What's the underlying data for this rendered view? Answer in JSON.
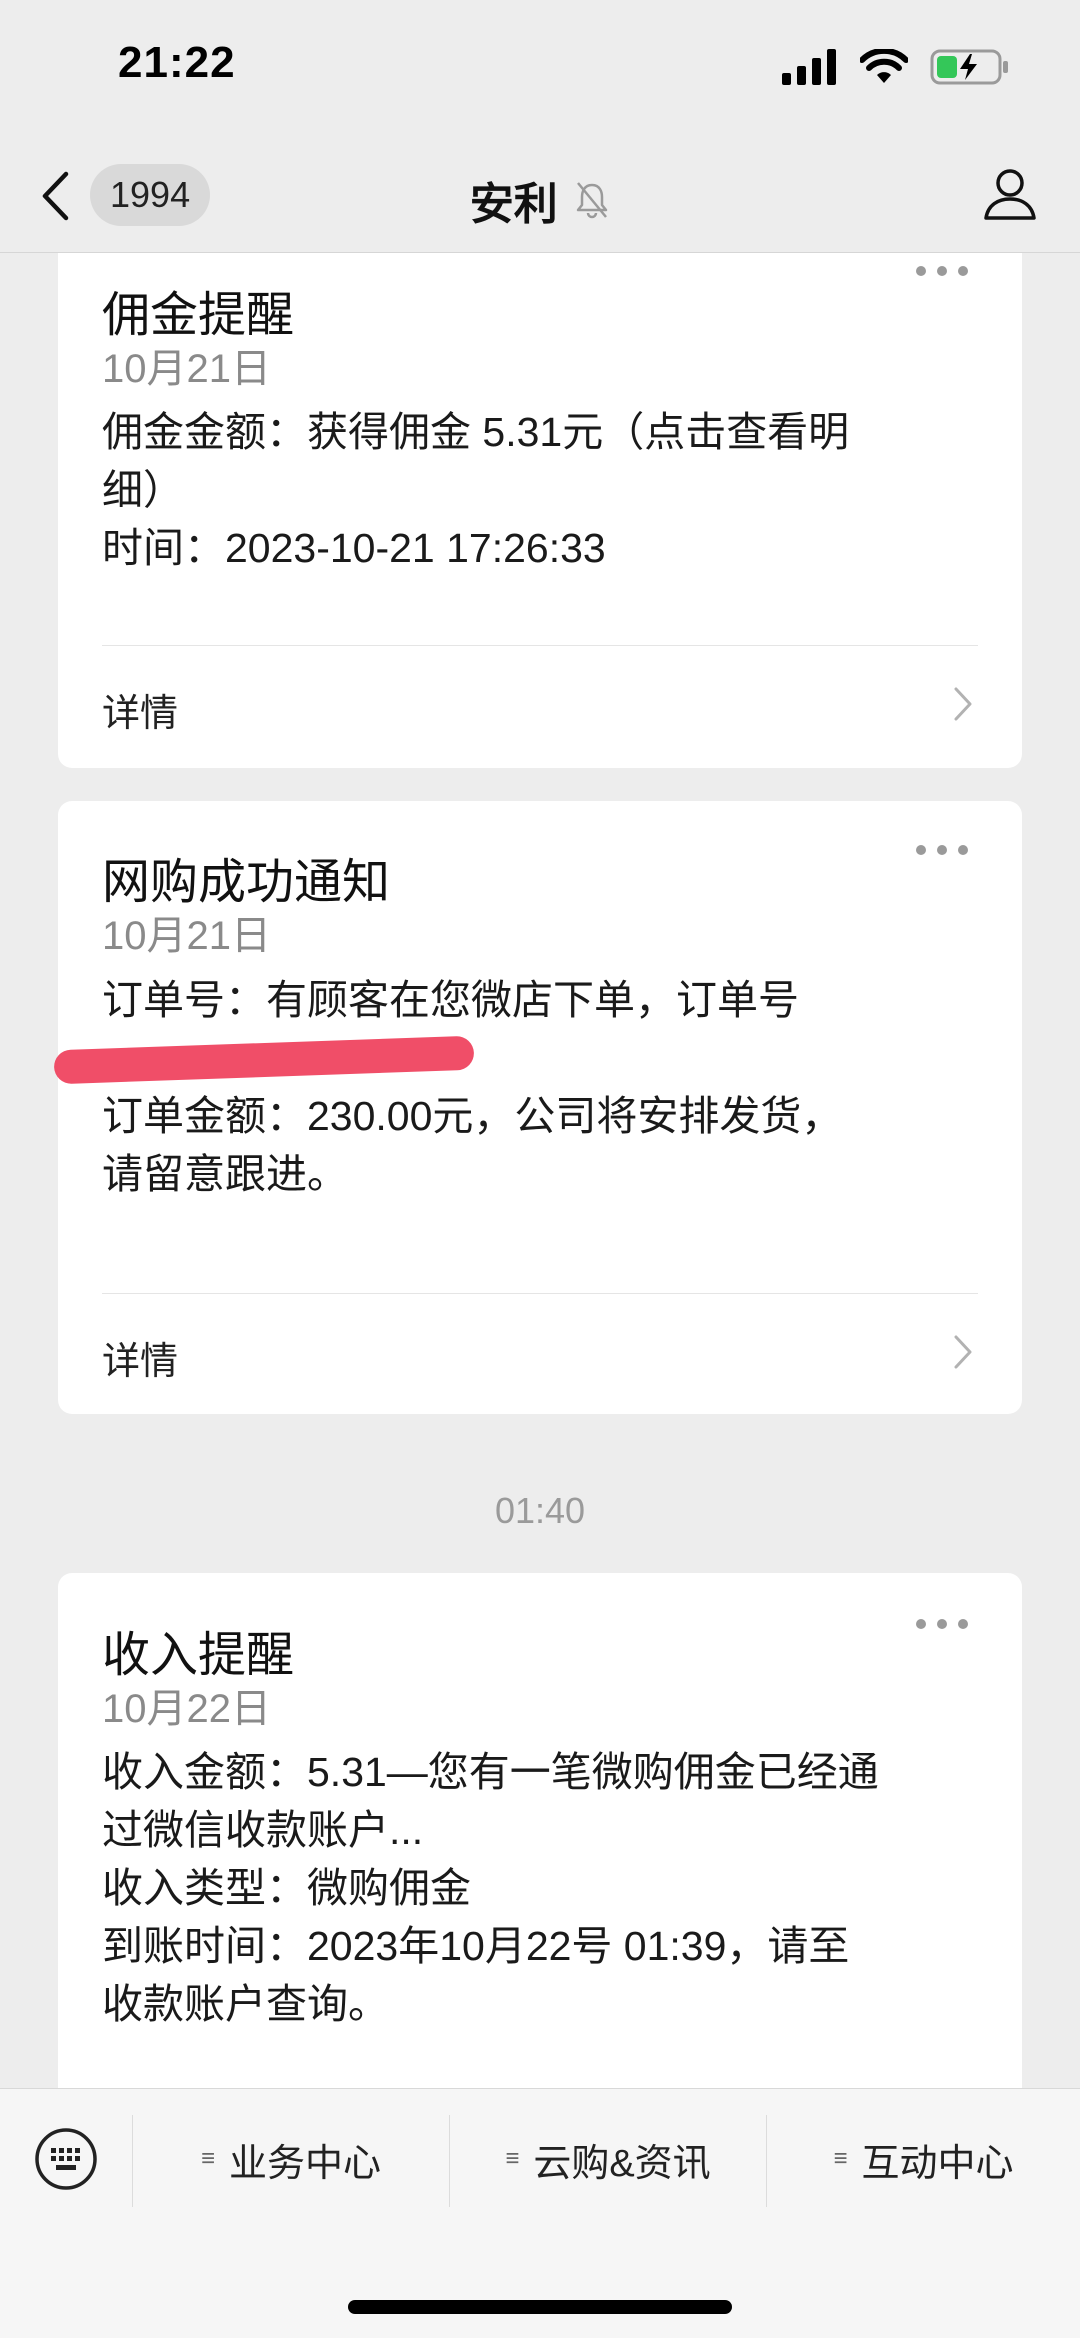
{
  "status_bar": {
    "time": "21:22",
    "battery": "charging"
  },
  "nav": {
    "unread_count": "1994",
    "title": "安利",
    "icons": [
      "back-icon",
      "bell-muted-icon",
      "profile-icon"
    ]
  },
  "cards": [
    {
      "title": "佣金提醒",
      "date": "10月21日",
      "lines": [
        "佣金金额：获得佣金 5.31元（点击查看明",
        "细）",
        "时间：2023-10-21 17:26:33"
      ],
      "detail_label": "详情"
    },
    {
      "title": "网购成功通知",
      "date": "10月21日",
      "lines": [
        "订单号：有顾客在您微店下单，订单号",
        "",
        "订单金额：230.00元，公司将安排发货，",
        "请留意跟进。"
      ],
      "detail_label": "详情"
    },
    {
      "title": "收入提醒",
      "date": "10月22日",
      "lines": [
        "收入金额：5.31—您有一笔微购佣金已经通",
        "过微信收款账户...",
        "收入类型：微购佣金",
        "到账时间：2023年10月22号 01:39，请至",
        "收款账户查询。"
      ]
    }
  ],
  "time_separator": "01:40",
  "bottom_menu": {
    "items": [
      "业务中心",
      "云购&资讯",
      "互动中心"
    ],
    "icons": [
      "keyboard-icon",
      "menu-list-icon"
    ]
  }
}
